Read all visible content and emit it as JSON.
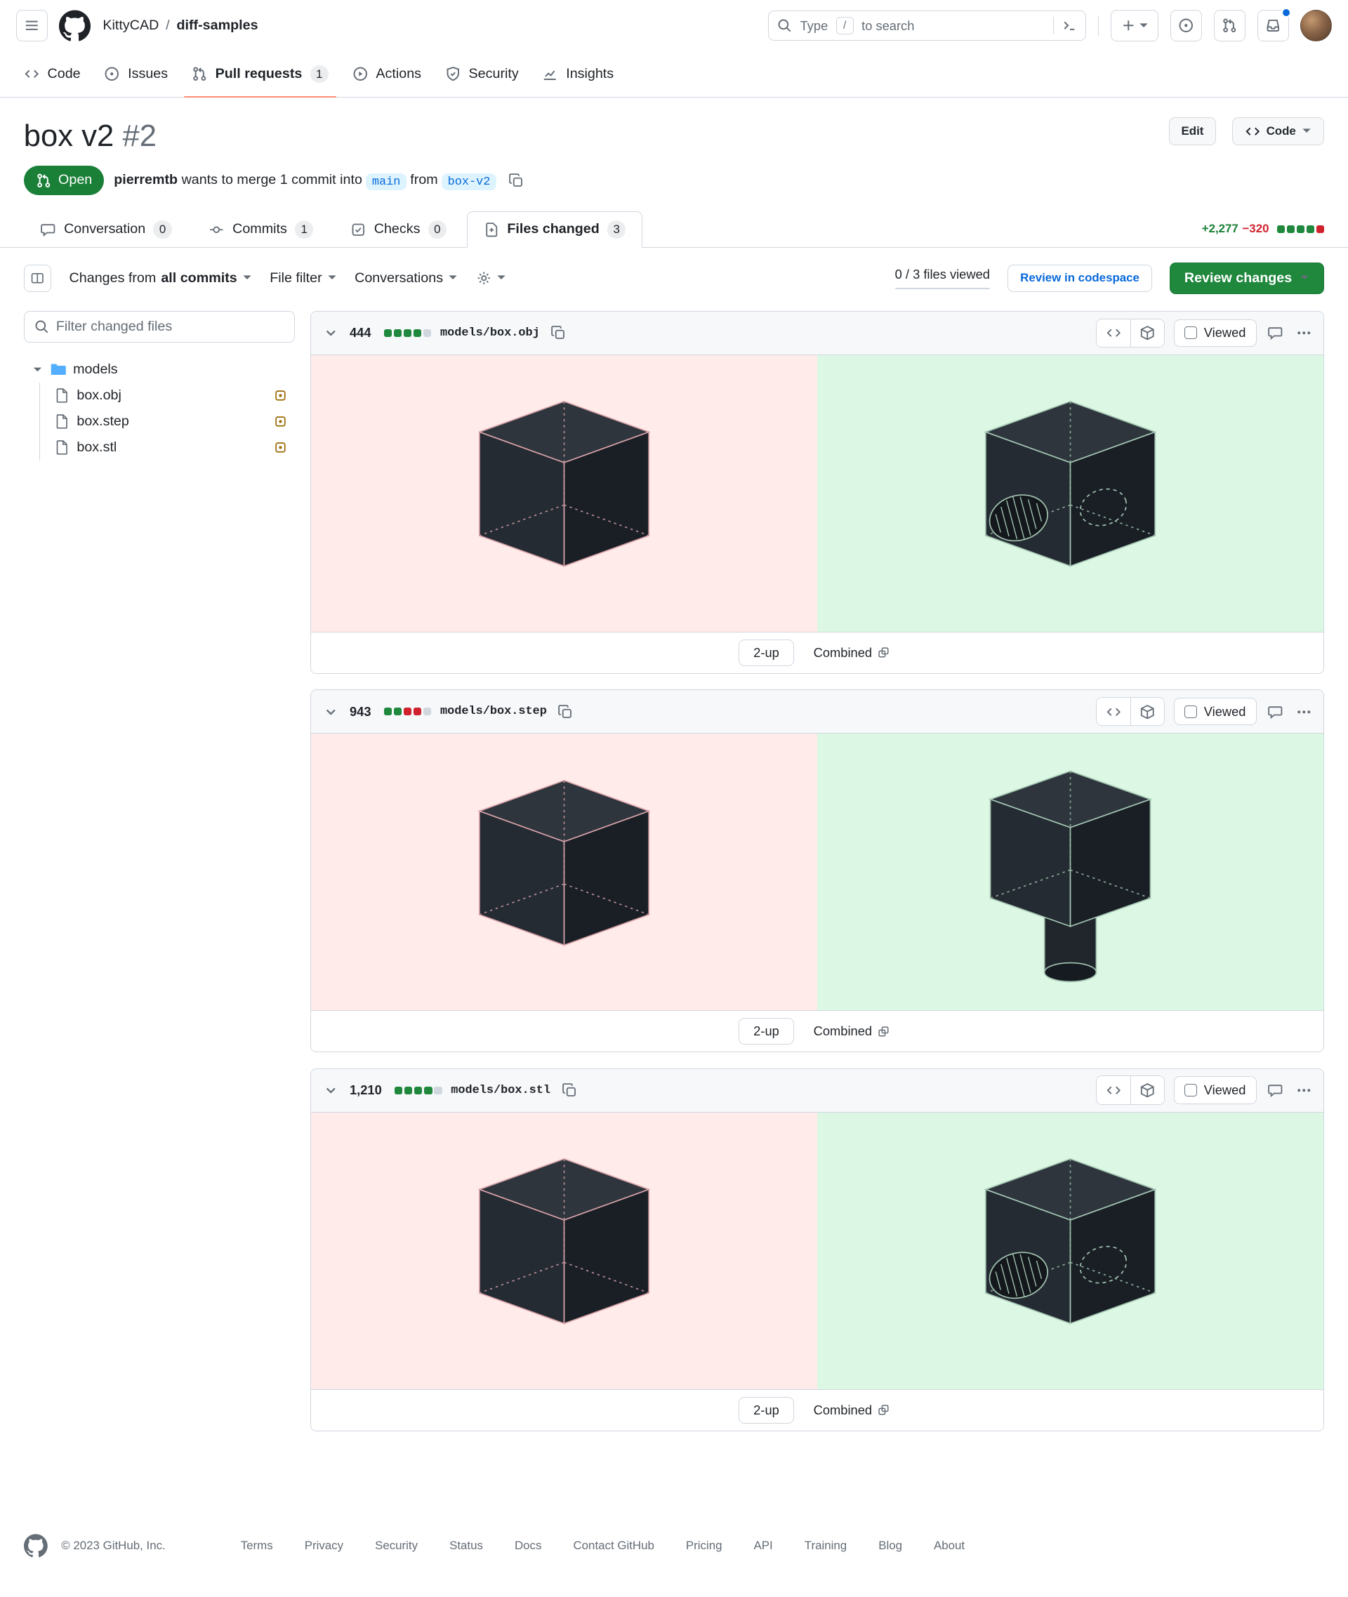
{
  "global_header": {
    "breadcrumb": {
      "org": "KittyCAD",
      "separator": "/",
      "repo": "diff-samples"
    },
    "search": {
      "prefix": "Type",
      "slash_key": "/",
      "suffix": "to search"
    }
  },
  "repo_nav": [
    {
      "label": "Code"
    },
    {
      "label": "Issues"
    },
    {
      "label": "Pull requests",
      "count": "1"
    },
    {
      "label": "Actions"
    },
    {
      "label": "Security"
    },
    {
      "label": "Insights"
    }
  ],
  "pr": {
    "title": "box v2",
    "number": "#2",
    "state": "Open",
    "actions": {
      "edit": "Edit",
      "code": "Code"
    },
    "merge": {
      "author": "pierremtb",
      "text1": " wants to merge 1 commit into ",
      "base": "main",
      "text2": " from ",
      "head": "box-v2"
    }
  },
  "pr_tabs": [
    {
      "label": "Conversation",
      "count": "0"
    },
    {
      "label": "Commits",
      "count": "1"
    },
    {
      "label": "Checks",
      "count": "0"
    },
    {
      "label": "Files changed",
      "count": "3"
    }
  ],
  "diffstat": {
    "additions": "+2,277",
    "deletions": "−320",
    "blocks": [
      "g",
      "g",
      "g",
      "g",
      "r"
    ]
  },
  "toolbar": {
    "changes_prefix": "Changes from",
    "changes_value": "all commits",
    "file_filter": "File filter",
    "conversations": "Conversations",
    "viewed_status": "0 / 3 files viewed",
    "review_codespace": "Review in codespace",
    "review_changes": "Review changes"
  },
  "sidebar": {
    "filter_placeholder": "Filter changed files",
    "folder": "models",
    "files": [
      {
        "name": "box.obj"
      },
      {
        "name": "box.step"
      },
      {
        "name": "box.stl"
      }
    ]
  },
  "labels": {
    "viewed": "Viewed",
    "two_up": "2-up",
    "combined": "Combined"
  },
  "files": [
    {
      "changes": "444",
      "path": "models/box.obj",
      "blocks": [
        "g",
        "g",
        "g",
        "g",
        "n"
      ]
    },
    {
      "changes": "943",
      "path": "models/box.step",
      "blocks": [
        "g",
        "g",
        "r",
        "r",
        "n"
      ]
    },
    {
      "changes": "1,210",
      "path": "models/box.stl",
      "blocks": [
        "g",
        "g",
        "g",
        "g",
        "n"
      ]
    }
  ],
  "footer": {
    "copyright": "© 2023 GitHub, Inc.",
    "links": [
      "Terms",
      "Privacy",
      "Security",
      "Status",
      "Docs",
      "Contact GitHub",
      "Pricing",
      "API",
      "Training",
      "Blog",
      "About"
    ]
  },
  "colors": {
    "accent_blue": "#0969da",
    "open_green": "#1a7f37",
    "button_green": "#1f883d",
    "tab_underline": "#fd8c73",
    "deleted_bg": "#ffebe9",
    "added_bg": "#dcf7e4",
    "block_green": "#1f883d",
    "block_red": "#cf222e",
    "block_neutral": "#d0d7de"
  }
}
